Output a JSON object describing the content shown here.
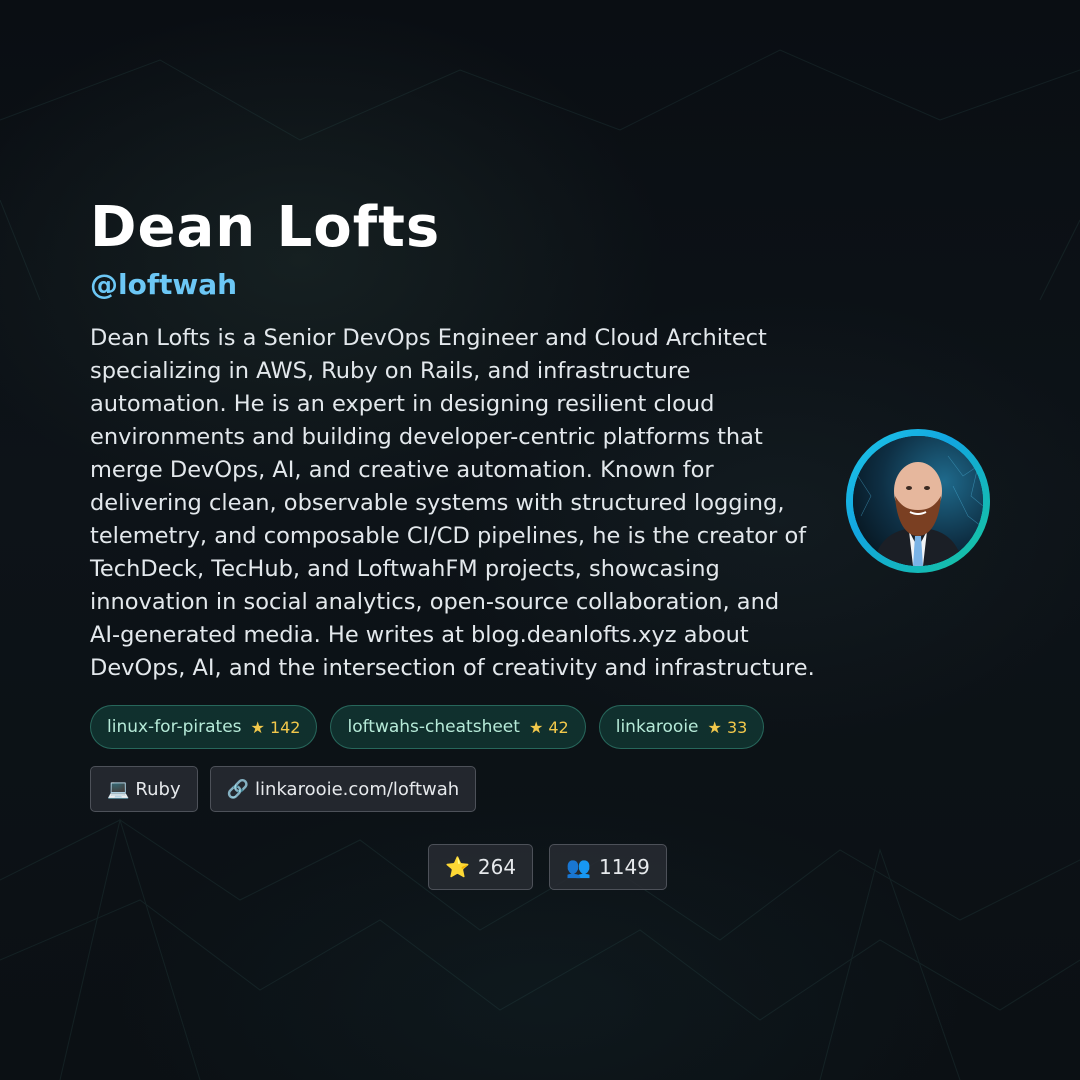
{
  "profile": {
    "name": "Dean Lofts",
    "handle": "@loftwah",
    "bio": "Dean Lofts is a Senior DevOps Engineer and Cloud Architect specializing in AWS, Ruby on Rails, and infrastructure automation. He is an expert in designing resilient cloud environments and building developer-centric platforms that merge DevOps, AI, and creative automation. Known for delivering clean, observable systems with structured logging, telemetry, and composable CI/CD pipelines, he is the creator of TechDeck, TecHub, and LoftwahFM projects, showcasing innovation in social analytics, open-source collaboration, and AI-generated media. He writes at blog.deanlofts.xyz about DevOps, AI, and the intersection of creativity and infrastructure."
  },
  "repos": [
    {
      "name": "linux-for-pirates",
      "stars": "★ 142"
    },
    {
      "name": "loftwahs-cheatsheet",
      "stars": "★ 42"
    },
    {
      "name": "linkarooie",
      "stars": "★ 33"
    }
  ],
  "meta": {
    "language": {
      "icon": "💻",
      "label": "Ruby"
    },
    "link": {
      "icon": "🔗",
      "label": "linkarooie.com/loftwah"
    }
  },
  "stats": {
    "stars": {
      "icon": "⭐",
      "value": "264"
    },
    "followers": {
      "icon": "👥",
      "value": "1149"
    }
  },
  "colors": {
    "accent": "#6cc7f5",
    "ring_start": "#1ec8e8",
    "ring_end": "#16c79a",
    "repo_chip_bg": "#14483f",
    "star_color": "#f2c84b"
  }
}
